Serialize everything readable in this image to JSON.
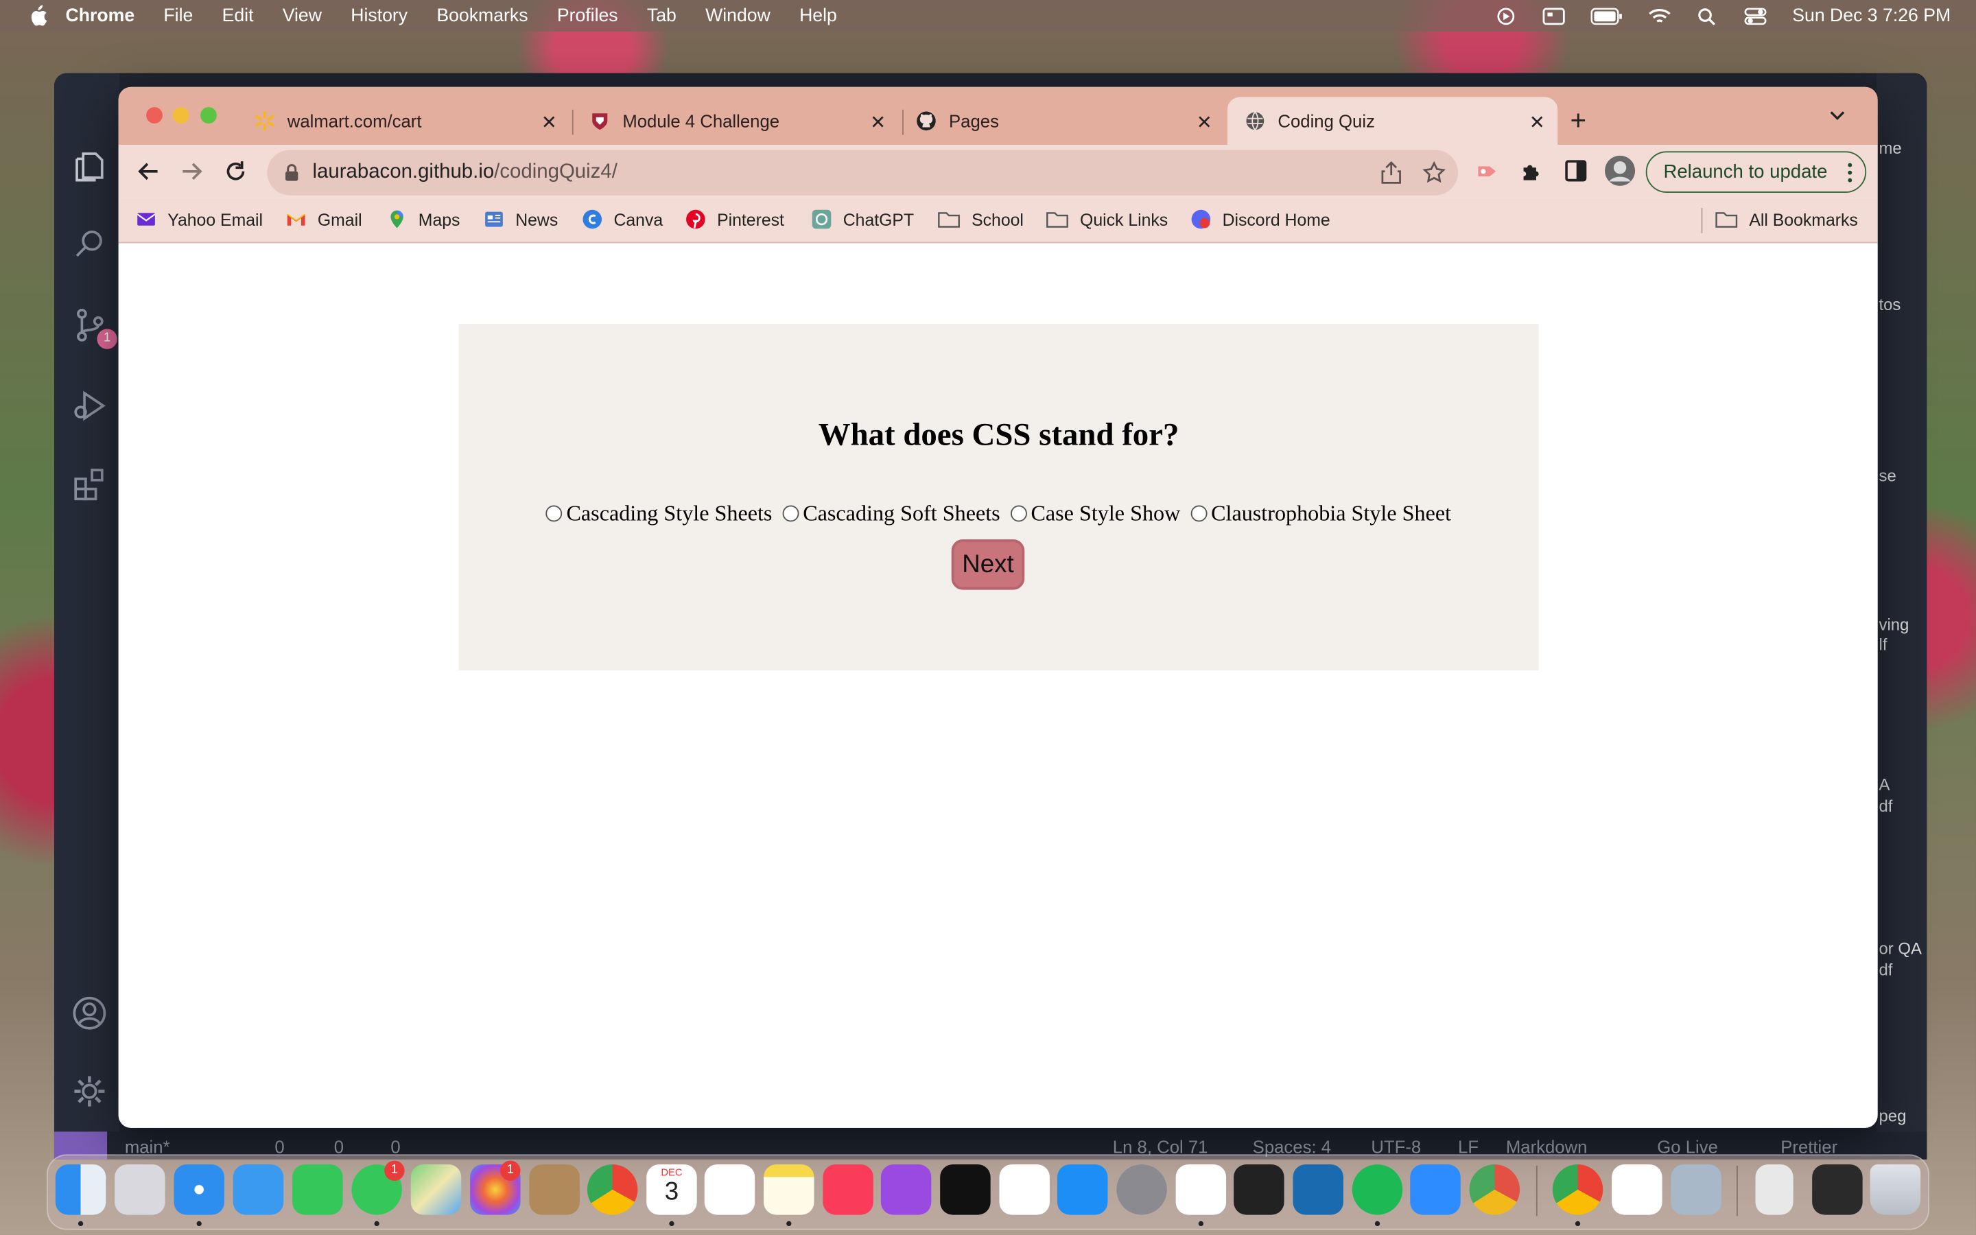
{
  "menubar": {
    "app": "Chrome",
    "items": [
      "File",
      "Edit",
      "View",
      "History",
      "Bookmarks",
      "Profiles",
      "Tab",
      "Window",
      "Help"
    ],
    "clock": "Sun Dec 3  7:26 PM"
  },
  "tabs": [
    {
      "title": "walmart.com/cart",
      "icon": "walmart-icon",
      "color": "#f5b71a"
    },
    {
      "title": "Module 4 Challenge",
      "icon": "shield-icon",
      "color": "#a8243c"
    },
    {
      "title": "Pages",
      "icon": "github-icon",
      "color": "#222222"
    },
    {
      "title": "Coding Quiz",
      "icon": "globe-icon",
      "color": "#555555",
      "active": true
    }
  ],
  "address": {
    "host": "laurabacon.github.io",
    "path": "/codingQuiz4/"
  },
  "toolbar": {
    "relaunch_label": "Relaunch to update"
  },
  "bookmarks": [
    {
      "label": "Yahoo Email",
      "icon": "yahoo-mail-icon"
    },
    {
      "label": "Gmail",
      "icon": "gmail-icon"
    },
    {
      "label": "Maps",
      "icon": "maps-icon"
    },
    {
      "label": "News",
      "icon": "news-icon"
    },
    {
      "label": "Canva",
      "icon": "canva-icon"
    },
    {
      "label": "Pinterest",
      "icon": "pinterest-icon"
    },
    {
      "label": "ChatGPT",
      "icon": "chatgpt-icon"
    },
    {
      "label": "School",
      "icon": "folder-icon"
    },
    {
      "label": "Quick Links",
      "icon": "folder-icon"
    },
    {
      "label": "Discord Home",
      "icon": "discord-icon"
    }
  ],
  "all_bookmarks": "All Bookmarks",
  "quiz": {
    "question": "What does CSS stand for?",
    "options": [
      "Cascading Style Sheets",
      "Cascading Soft Sheets",
      "Case Style Show",
      "Claustrophobia Style Sheet"
    ],
    "next_label": "Next"
  },
  "vscode": {
    "scm_badge": "1",
    "right_fragments": [
      "me",
      "tos",
      "se",
      "ving",
      "lf",
      "A",
      "df",
      "or QA",
      "df",
      "peg"
    ],
    "status": {
      "branch": "main*",
      "errors": "0",
      "warnings": "0",
      "ports": "0",
      "position": "Ln 8, Col 71",
      "spaces": "Spaces: 4",
      "encoding": "UTF-8",
      "eol": "LF",
      "language": "Markdown",
      "golive": "Go Live",
      "prettier": "Prettier"
    }
  },
  "dock": {
    "calendar_month": "DEC",
    "calendar_day": "3",
    "messages_badge": "1",
    "photos_badge": "1",
    "apps": [
      "finder",
      "launchpad",
      "safari",
      "mail",
      "facetime",
      "messages",
      "maps",
      "photos",
      "contacts",
      "chrome",
      "calendar",
      "reminders",
      "notes",
      "music",
      "podcasts",
      "tv",
      "news",
      "app-store",
      "system-settings",
      "vscode",
      "terminal",
      "kindle",
      "spotify",
      "zoom",
      "chrome-canary",
      "chrome-2",
      "slack",
      "preview",
      "archive",
      "screenshot",
      "trash"
    ]
  }
}
